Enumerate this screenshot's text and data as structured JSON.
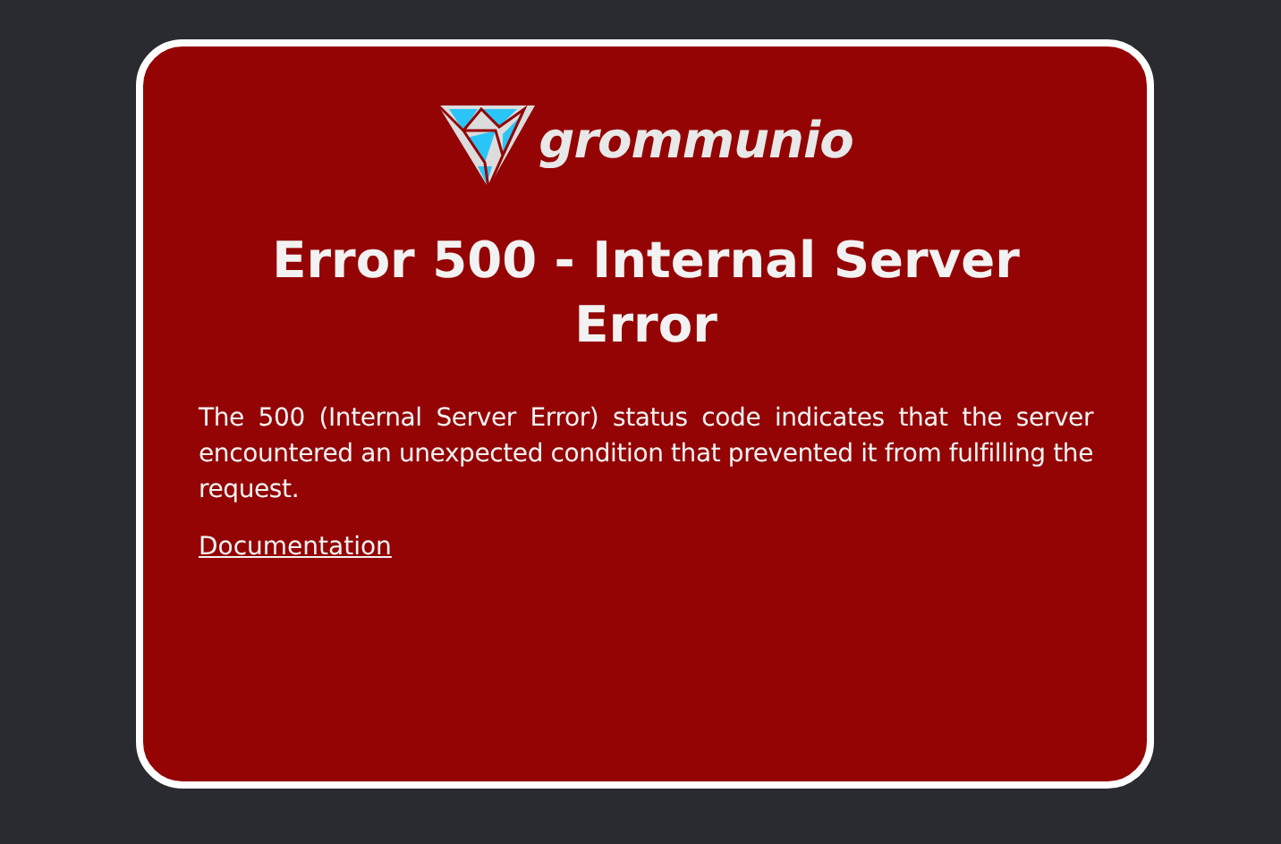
{
  "logo": {
    "text": "grommunio"
  },
  "title": "Error 500 - Internal Server Error",
  "message": "The 500 (Internal Server Error) status code indicates that the server encountered an unexpected condition that prevented it from fulfilling the request.",
  "link": "Documentation"
}
